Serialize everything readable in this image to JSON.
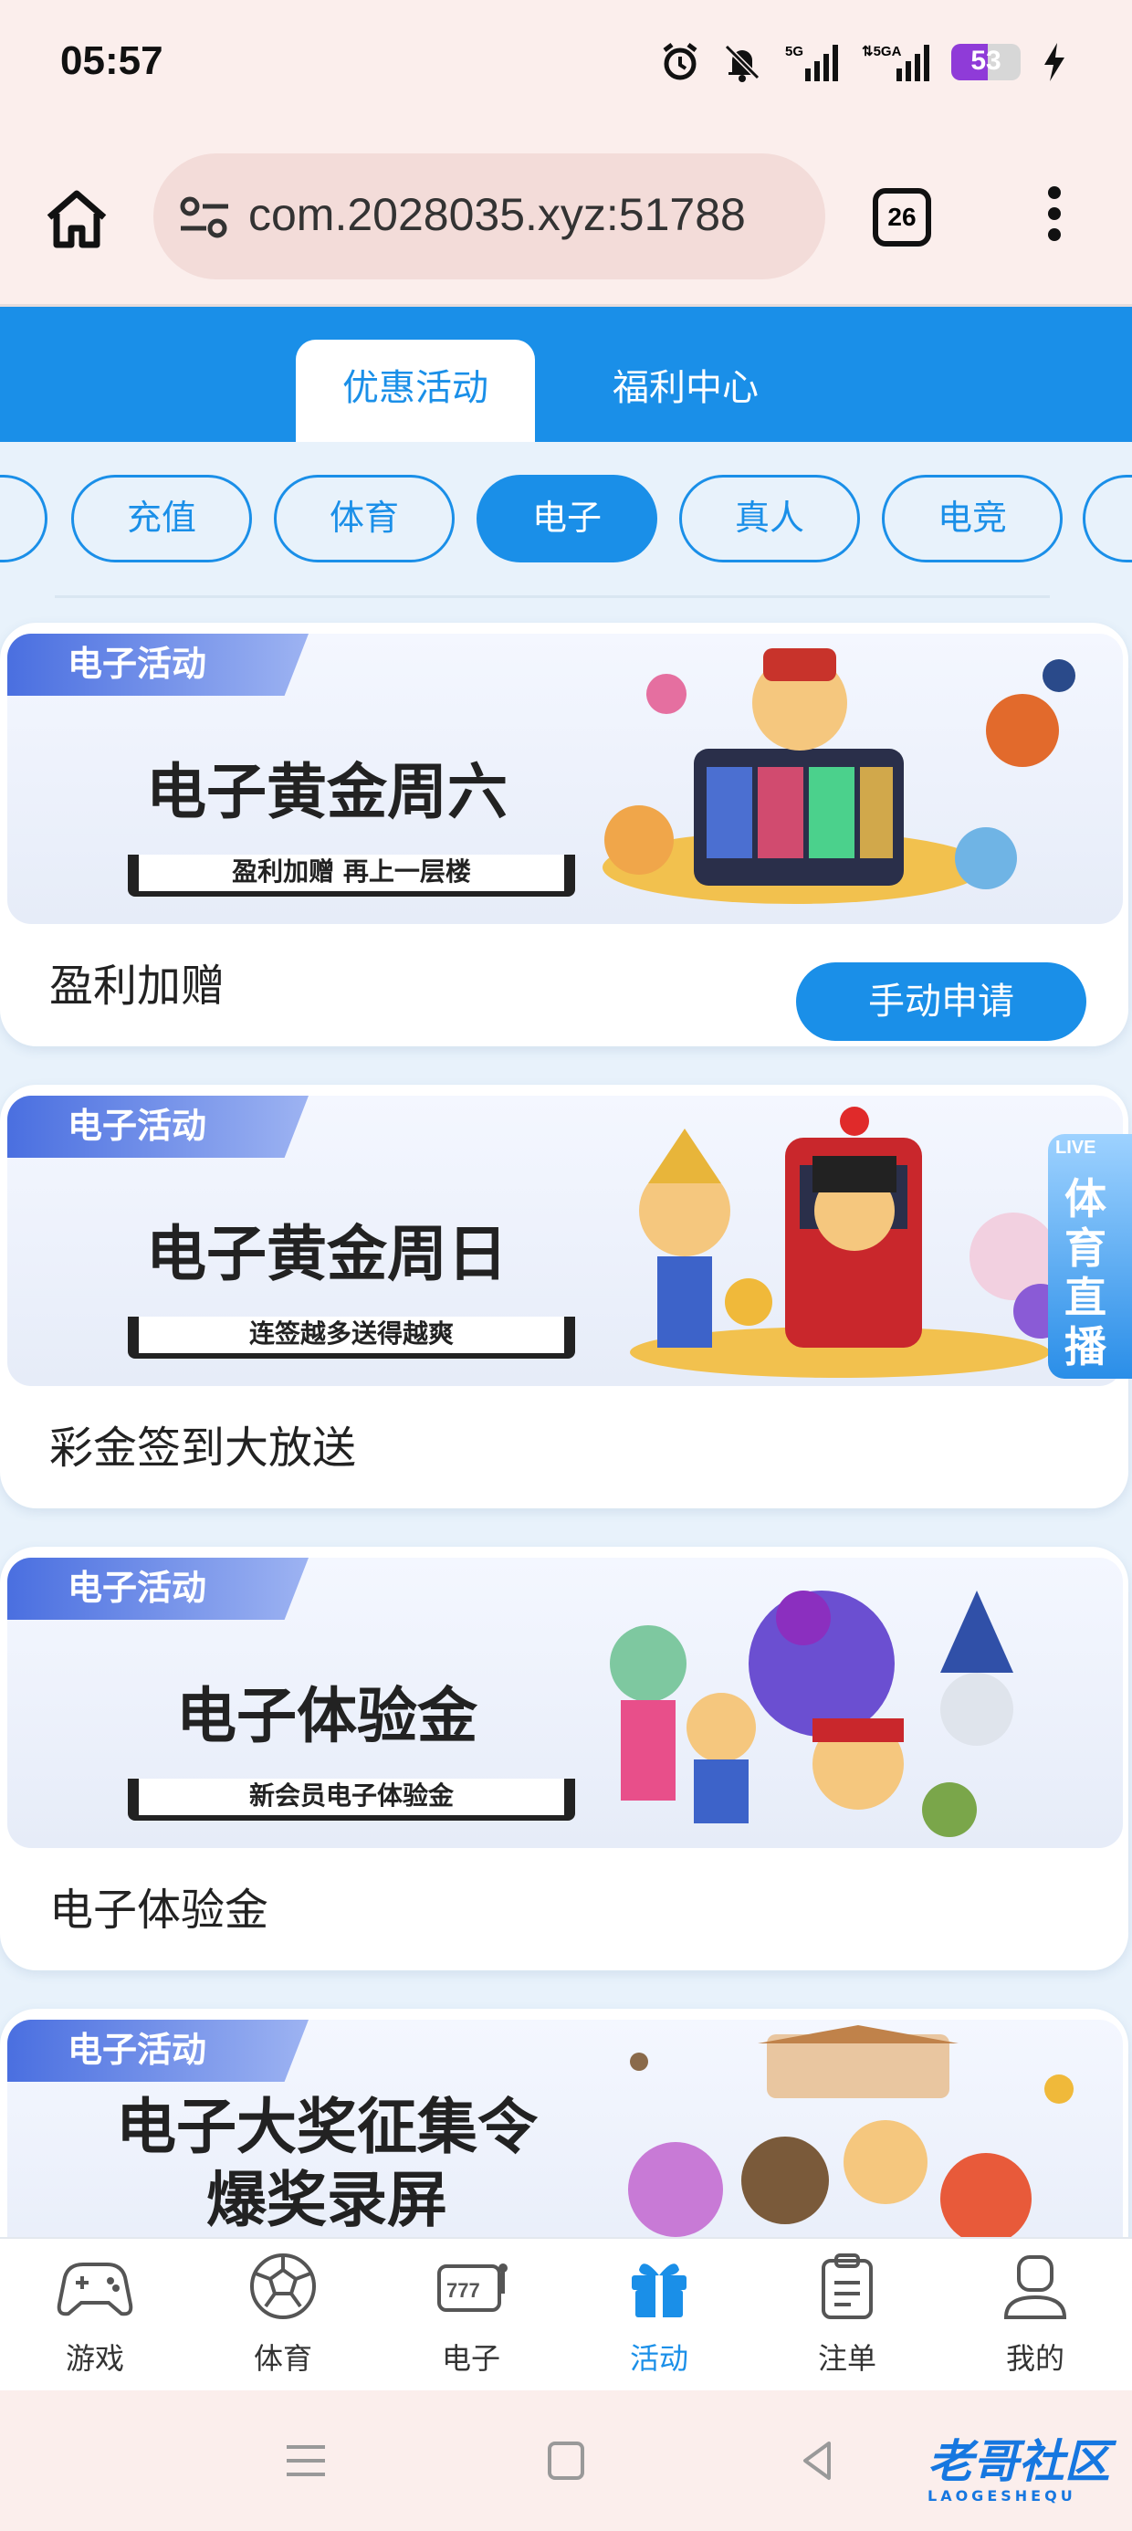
{
  "status_bar": {
    "time": "05:57",
    "battery_level": "53",
    "icons": [
      "alarm-icon",
      "mute-bell-icon",
      "signal-5g-icon",
      "signal-5ga-icon",
      "battery-icon",
      "charging-icon"
    ]
  },
  "browser": {
    "url": "com.2028035.xyz:51788",
    "tab_count": "26"
  },
  "top_tabs": [
    {
      "label": "优惠活动",
      "active": true
    },
    {
      "label": "福利中心",
      "active": false
    }
  ],
  "categories": [
    {
      "label": "充值",
      "active": false
    },
    {
      "label": "体育",
      "active": false
    },
    {
      "label": "电子",
      "active": true
    },
    {
      "label": "真人",
      "active": false
    },
    {
      "label": "电竞",
      "active": false
    }
  ],
  "promotions": [
    {
      "tag": "电子活动",
      "banner_title": "电子黄金周六",
      "banner_subtitle": "盈利加赠 再上一层楼",
      "title": "盈利加赠",
      "action": "手动申请"
    },
    {
      "tag": "电子活动",
      "banner_title": "电子黄金周日",
      "banner_subtitle": "连签越多送得越爽",
      "title": "彩金签到大放送"
    },
    {
      "tag": "电子活动",
      "banner_title": "电子体验金",
      "banner_subtitle": "新会员电子体验金",
      "title": "电子体验金"
    },
    {
      "tag": "电子活动",
      "banner_title_line1": "电子大奖征集令",
      "banner_title_line2": "爆奖录屏"
    }
  ],
  "live_badge": {
    "top": "LIVE",
    "text": "体育直播"
  },
  "bottom_nav": [
    {
      "label": "游戏",
      "icon": "gamepad-icon"
    },
    {
      "label": "体育",
      "icon": "soccer-ball-icon"
    },
    {
      "label": "电子",
      "icon": "slot-machine-icon"
    },
    {
      "label": "活动",
      "icon": "gift-icon",
      "active": true
    },
    {
      "label": "注单",
      "icon": "clipboard-icon"
    },
    {
      "label": "我的",
      "icon": "user-icon"
    }
  ],
  "watermark": {
    "text": "老哥社区",
    "sub": "LAOGESHEQU"
  }
}
